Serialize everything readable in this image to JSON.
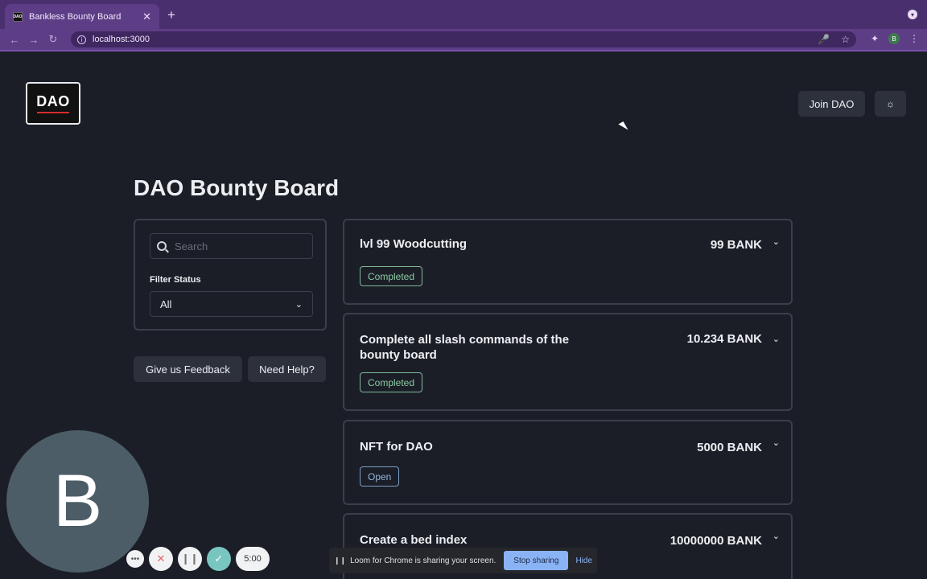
{
  "browser": {
    "tab_title": "Bankless Bounty Board",
    "tab_favicon_text": "DAO",
    "tab_close": "✕",
    "new_tab": "+",
    "url": "localhost:3000",
    "profile_initial": "B"
  },
  "header": {
    "logo_text": "DAO",
    "join_label": "Join DAO",
    "theme_icon": "sun-icon"
  },
  "page": {
    "title": "DAO Bounty Board"
  },
  "filter": {
    "search_placeholder": "Search",
    "status_label": "Filter Status",
    "status_value": "All"
  },
  "actions": {
    "feedback_label": "Give us Feedback",
    "help_label": "Need Help?"
  },
  "bounties": [
    {
      "title": "lvl 99 Woodcutting",
      "reward": "99 BANK",
      "status": "Completed"
    },
    {
      "title": "Complete all slash commands of the bounty board",
      "reward": "10.234 BANK",
      "status": "Completed"
    },
    {
      "title": "NFT for DAO",
      "reward": "5000 BANK",
      "status": "Open"
    },
    {
      "title": "Create a bed index",
      "reward": "10000000 BANK",
      "status": ""
    }
  ],
  "loom": {
    "avatar_initial": "B",
    "timer": "5:00",
    "share_text": "Loom for Chrome is sharing your screen.",
    "stop_label": "Stop sharing",
    "hide_label": "Hide"
  },
  "colors": {
    "background": "#1b1e27",
    "chrome_purple": "#5e3d87",
    "completed_badge": "#8ccaa3",
    "open_badge": "#94b4dc",
    "logo_accent": "#d72d2d"
  }
}
